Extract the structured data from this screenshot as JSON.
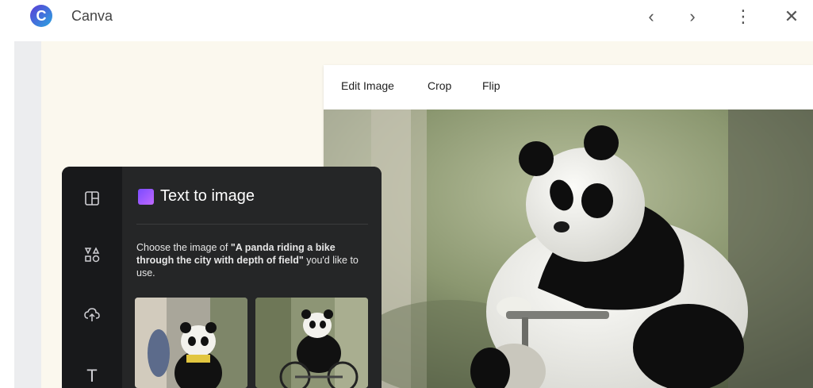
{
  "app": {
    "title": "Canva",
    "logo_letter": "C"
  },
  "nav": {
    "back_icon": "‹",
    "forward_icon": "›",
    "more_icon": "⋮",
    "close_icon": "✕"
  },
  "toolbar": {
    "edit_image": "Edit Image",
    "crop": "Crop",
    "flip": "Flip"
  },
  "panel": {
    "title": "Text to image",
    "desc_prefix": "Choose the image of ",
    "prompt": "\"A panda riding a bike through the city with depth of field\"",
    "desc_suffix": " you'd like to use."
  },
  "rail": {
    "items": [
      "design-icon",
      "elements-icon",
      "uploads-icon",
      "text-icon"
    ],
    "text_glyph": "T"
  },
  "colors": {
    "panel_bg": "#252627",
    "rail_bg": "#18191b",
    "canvas_bg": "#fbf8ee"
  }
}
